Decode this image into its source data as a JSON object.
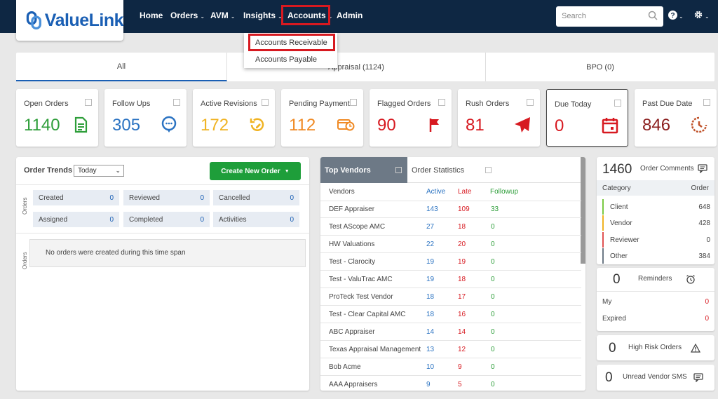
{
  "header": {
    "logo_text": "ValueLink",
    "nav": [
      {
        "label": "Home",
        "caret": ""
      },
      {
        "label": "Orders",
        "caret": "⌄"
      },
      {
        "label": "AVM",
        "caret": "⌄"
      },
      {
        "label": "Insights",
        "caret": "⌄"
      },
      {
        "label": "Accounts",
        "caret": "⌄"
      },
      {
        "label": "Admin",
        "caret": ""
      }
    ],
    "search_placeholder": "Search",
    "help_caret": "⌄",
    "settings_caret": "⌄"
  },
  "accounts_menu": {
    "items": [
      "Accounts Receivable",
      "Accounts Payable"
    ]
  },
  "tabs": [
    "All",
    "Appraisal (1124)",
    "BPO (0)"
  ],
  "cards": [
    {
      "label": "Open Orders",
      "value": "1140",
      "color": "#2e9e3a",
      "icon": "document-icon"
    },
    {
      "label": "Follow Ups",
      "value": "305",
      "color": "#2b73c2",
      "icon": "chat-bubble-icon"
    },
    {
      "label": "Active Revisions",
      "value": "172",
      "color": "#f0b323",
      "icon": "revision-icon"
    },
    {
      "label": "Pending Payment",
      "value": "112",
      "color": "#f08a24",
      "icon": "payment-clock-icon"
    },
    {
      "label": "Flagged Orders",
      "value": "90",
      "color": "#d71920",
      "icon": "flag-icon"
    },
    {
      "label": "Rush Orders",
      "value": "81",
      "color": "#d71920",
      "icon": "paper-plane-icon"
    },
    {
      "label": "Due Today",
      "value": "0",
      "color": "#d71920",
      "icon": "calendar-icon"
    },
    {
      "label": "Past Due Date",
      "value": "846",
      "color": "#8b1e1e",
      "icon": "past-due-clock-icon"
    }
  ],
  "order_trends": {
    "title": "Order Trends",
    "period": "Today",
    "create_label": "Create New Order",
    "orders_label": "Orders",
    "stats": [
      {
        "label": "Created",
        "value": "0"
      },
      {
        "label": "Reviewed",
        "value": "0"
      },
      {
        "label": "Cancelled",
        "value": "0"
      },
      {
        "label": "Assigned",
        "value": "0"
      },
      {
        "label": "Completed",
        "value": "0"
      },
      {
        "label": "Activities",
        "value": "0"
      }
    ],
    "empty_message": "No orders were created during this time span"
  },
  "vendors": {
    "tab_active": "Top Vendors",
    "tab_other": "Order Statistics",
    "headers": {
      "vendor": "Vendors",
      "active": "Active",
      "late": "Late",
      "followup": "Followup"
    },
    "rows": [
      {
        "name": "DEF Appraiser",
        "active": "143",
        "late": "109",
        "followup": "33"
      },
      {
        "name": "Test AScope AMC",
        "active": "27",
        "late": "18",
        "followup": "0"
      },
      {
        "name": "HW Valuations",
        "active": "22",
        "late": "20",
        "followup": "0"
      },
      {
        "name": "Test - Clarocity",
        "active": "19",
        "late": "19",
        "followup": "0"
      },
      {
        "name": "Test - ValuTrac AMC",
        "active": "19",
        "late": "18",
        "followup": "0"
      },
      {
        "name": "ProTeck Test Vendor",
        "active": "18",
        "late": "17",
        "followup": "0"
      },
      {
        "name": "Test - Clear Capital AMC",
        "active": "18",
        "late": "16",
        "followup": "0"
      },
      {
        "name": "ABC Appraiser",
        "active": "14",
        "late": "14",
        "followup": "0"
      },
      {
        "name": "Texas Appraisal Management",
        "active": "13",
        "late": "12",
        "followup": "0"
      },
      {
        "name": "Bob Acme",
        "active": "10",
        "late": "9",
        "followup": "0"
      },
      {
        "name": "AAA Appraisers",
        "active": "9",
        "late": "5",
        "followup": "0"
      }
    ]
  },
  "comments": {
    "count": "1460",
    "label": "Order Comments",
    "col_category": "Category",
    "col_order": "Order",
    "rows": [
      {
        "label": "Client",
        "value": "648",
        "color": "#7ac943"
      },
      {
        "label": "Vendor",
        "value": "428",
        "color": "#f0b323"
      },
      {
        "label": "Reviewer",
        "value": "0",
        "color": "#e05252"
      },
      {
        "label": "Other",
        "value": "384",
        "color": "#6d7986"
      }
    ]
  },
  "reminders": {
    "count": "0",
    "label": "Reminders",
    "rows": [
      {
        "label": "My",
        "value": "0"
      },
      {
        "label": "Expired",
        "value": "0"
      }
    ]
  },
  "high_risk": {
    "count": "0",
    "label": "High Risk Orders"
  },
  "vendor_sms": {
    "count": "0",
    "label": "Unread Vendor SMS"
  }
}
